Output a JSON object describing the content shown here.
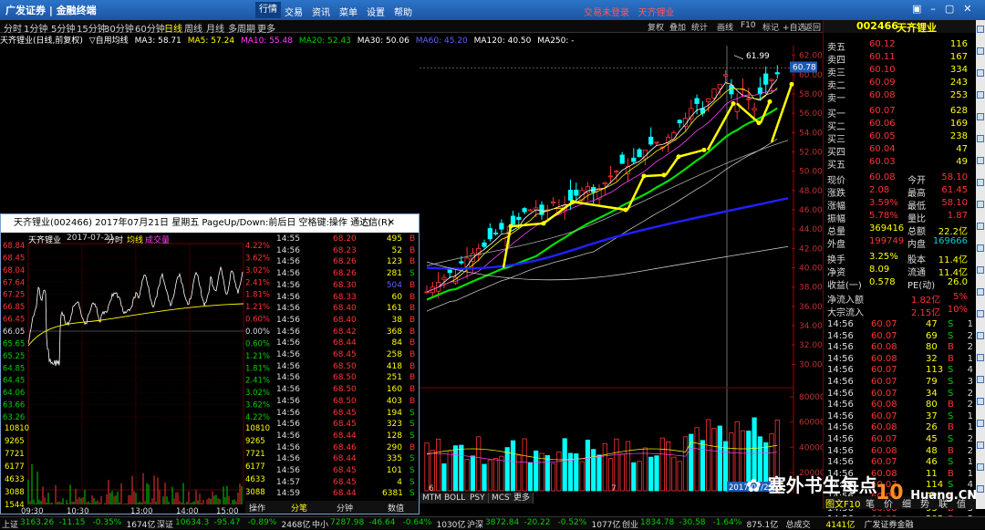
{
  "app": {
    "logo": "广发证券",
    "product": "金融终端",
    "login_notice": "交易未登录",
    "stock_header": "天齐锂业"
  },
  "menus": [
    "行情",
    "交易",
    "资讯",
    "菜单",
    "设置",
    "帮助"
  ],
  "timeframes": [
    "分时",
    "1分钟",
    "5分钟",
    "15分钟",
    "30分钟",
    "60分钟",
    "日线",
    "周线",
    "月线",
    "多周期",
    "更多"
  ],
  "toolbar_right": [
    "复权",
    "叠加",
    "统计",
    "画线",
    "F10",
    "标记",
    "+自选",
    "返回"
  ],
  "indicator": {
    "title": "天齐锂业(日线,前复权)",
    "formula": "▽自用均线",
    "ma3": "MA3: 58.71",
    "ma5": "MA5: 57.24",
    "ma10": "MA10: 55.48",
    "ma20": "MA20: 52.43",
    "ma30": "MA30: 50.06",
    "ma60": "MA60: 45.20",
    "ma120": "MA120: 40.50",
    "ma250": "MA250: -"
  },
  "chart_data": {
    "type": "candlestick",
    "price_axis": [
      "62.00",
      "60.00",
      "58.00",
      "56.00",
      "54.00",
      "52.00",
      "50.00",
      "48.00",
      "46.00",
      "44.00",
      "42.00",
      "40.00",
      "38.00",
      "36.00",
      "34.00",
      "32.00",
      "30.00"
    ],
    "volume_axis": [
      "80000",
      "60000",
      "40000",
      "20000"
    ],
    "high_label": "61.99",
    "current_price": "60.78",
    "x_labels": [
      "6",
      "7"
    ],
    "date_badge": "2017/07/21",
    "ylim": [
      29,
      63
    ]
  },
  "subtabs": [
    "MTM",
    "BOLL",
    "PSY",
    "MCST",
    "更多"
  ],
  "quote": {
    "code": "002466",
    "name": "天齐锂业",
    "asks": [
      [
        "卖五",
        "60.12",
        "116"
      ],
      [
        "卖四",
        "60.11",
        "167"
      ],
      [
        "卖三",
        "60.10",
        "334"
      ],
      [
        "卖二",
        "60.09",
        "243"
      ],
      [
        "卖一",
        "60.08",
        "253"
      ]
    ],
    "bids": [
      [
        "买一",
        "60.07",
        "628"
      ],
      [
        "买二",
        "60.06",
        "169"
      ],
      [
        "买三",
        "60.05",
        "238"
      ],
      [
        "买四",
        "60.04",
        "47"
      ],
      [
        "买五",
        "60.03",
        "49"
      ]
    ],
    "stats": [
      [
        "现价",
        "60.08",
        "今开",
        "58.10"
      ],
      [
        "涨跌",
        "2.08",
        "最高",
        "61.45"
      ],
      [
        "涨幅",
        "3.59%",
        "最低",
        "58.10"
      ],
      [
        "振幅",
        "5.78%",
        "量比",
        "1.87"
      ],
      [
        "总量",
        "369416",
        "总额",
        "22.2亿"
      ],
      [
        "外盘",
        "199749",
        "内盘",
        "169666"
      ],
      [
        "换手",
        "3.25%",
        "股本",
        "11.4亿"
      ],
      [
        "净资",
        "8.09",
        "流通",
        "11.4亿"
      ],
      [
        "收益(一)",
        "0.578",
        "PE(动)",
        "26.0"
      ]
    ],
    "flows": [
      [
        "净流入额",
        "1.82亿",
        "5%"
      ],
      [
        "大宗流入",
        "2.15亿",
        "10%"
      ]
    ],
    "ticks": [
      [
        "14:56",
        "60.07",
        "47",
        "S",
        "1"
      ],
      [
        "14:56",
        "60.07",
        "69",
        "S",
        "2"
      ],
      [
        "14:56",
        "60.08",
        "80",
        "B",
        "2"
      ],
      [
        "14:56",
        "60.08",
        "32",
        "B",
        "1"
      ],
      [
        "14:56",
        "60.07",
        "113",
        "S",
        "4"
      ],
      [
        "14:56",
        "60.07",
        "79",
        "S",
        "3"
      ],
      [
        "14:56",
        "60.07",
        "34",
        "S",
        "2"
      ],
      [
        "14:56",
        "60.08",
        "80",
        "B",
        "2"
      ],
      [
        "14:56",
        "60.07",
        "37",
        "S",
        "1"
      ],
      [
        "14:56",
        "60.08",
        "26",
        "B",
        "1"
      ],
      [
        "14:56",
        "60.07",
        "45",
        "S",
        "2"
      ],
      [
        "14:56",
        "60.08",
        "48",
        "B",
        "2"
      ],
      [
        "14:56",
        "60.07",
        "46",
        "S",
        "1"
      ],
      [
        "14:56",
        "60.08",
        "11",
        "B",
        "1"
      ],
      [
        "14:56",
        "60.07",
        "114",
        "S",
        "4"
      ],
      [
        "14:56",
        "60.08",
        "28",
        "B",
        "1"
      ],
      [
        "14:56",
        "60.08",
        "93",
        "B",
        "3"
      ],
      [
        "14:56",
        "60.08",
        "203",
        "B",
        "3"
      ]
    ],
    "tabs": [
      "图文F10",
      "笔",
      "价",
      "细",
      "势",
      "联",
      "值"
    ]
  },
  "popup": {
    "title": "天齐锂业(002466) 2017年07月21日 星期五 PageUp/Down:前后日 空格键:操作 通达信(R)",
    "info": [
      "天齐锂业",
      "2017-07-21",
      "分时",
      "均线",
      "成交量"
    ],
    "left_axis": [
      "68.84",
      "68.45",
      "68.04",
      "67.64",
      "67.25",
      "66.85",
      "66.45",
      "66.05",
      "65.65",
      "65.25",
      "64.85",
      "64.45",
      "64.06",
      "63.66",
      "63.26"
    ],
    "right_axis": [
      "4.22%",
      "3.62%",
      "3.02%",
      "2.41%",
      "1.81%",
      "1.21%",
      "0.60%",
      "0.00%",
      "0.60%",
      "1.21%",
      "1.81%",
      "2.41%",
      "3.02%",
      "3.62%",
      "4.22%"
    ],
    "vol_axis": [
      "10810",
      "9265",
      "7721",
      "6177",
      "4633",
      "3088",
      "1544"
    ],
    "time_axis": [
      "09:30",
      "10:30",
      "13:00",
      "14:00",
      "15:00"
    ],
    "ticks": [
      [
        "14:55",
        "68.20",
        "495",
        "B"
      ],
      [
        "14:56",
        "68.23",
        "52",
        "B"
      ],
      [
        "14:56",
        "68.26",
        "123",
        "B"
      ],
      [
        "14:56",
        "68.26",
        "281",
        "S"
      ],
      [
        "14:56",
        "68.30",
        "504",
        "B"
      ],
      [
        "14:56",
        "68.33",
        "60",
        "B"
      ],
      [
        "14:56",
        "68.40",
        "161",
        "B"
      ],
      [
        "14:56",
        "68.40",
        "38",
        "B"
      ],
      [
        "14:56",
        "68.42",
        "368",
        "B"
      ],
      [
        "14:56",
        "68.44",
        "84",
        "B"
      ],
      [
        "14:56",
        "68.45",
        "258",
        "B"
      ],
      [
        "14:56",
        "68.50",
        "418",
        "B"
      ],
      [
        "14:56",
        "68.50",
        "251",
        "B"
      ],
      [
        "14:56",
        "68.50",
        "160",
        "B"
      ],
      [
        "14:56",
        "68.50",
        "403",
        "B"
      ],
      [
        "14:56",
        "68.45",
        "194",
        "S"
      ],
      [
        "14:56",
        "68.45",
        "323",
        "S"
      ],
      [
        "14:56",
        "68.44",
        "128",
        "S"
      ],
      [
        "14:56",
        "68.46",
        "290",
        "B"
      ],
      [
        "14:56",
        "68.44",
        "335",
        "S"
      ],
      [
        "14:56",
        "68.45",
        "101",
        "S"
      ],
      [
        "14:57",
        "68.45",
        "4",
        "S"
      ],
      [
        "14:59",
        "68.44",
        "6381",
        "S"
      ]
    ],
    "tabs": [
      "操作",
      "分笔",
      "分钟",
      "数值"
    ]
  },
  "bottom": {
    "items": [
      [
        "上证",
        "3163.26",
        "-11.15",
        "-0.35%",
        "1674亿"
      ],
      [
        "深证",
        "10634.3",
        "-95.47",
        "-0.89%",
        "2468亿"
      ],
      [
        "中小",
        "7287.98",
        "-46.64",
        "-0.64%",
        "1030亿"
      ],
      [
        "沪深",
        "3872.84",
        "-20.22",
        "-0.52%",
        "1077亿"
      ],
      [
        "创业",
        "1834.78",
        "-30.58",
        "-1.64%",
        "875.1亿"
      ]
    ],
    "trade": "总成交",
    "trade_val": "4141亿",
    "broker": "广发证券金融"
  },
  "watermark": {
    "text1": "塞外书生每点",
    "text2": "10",
    "site": "Huang.CN"
  }
}
